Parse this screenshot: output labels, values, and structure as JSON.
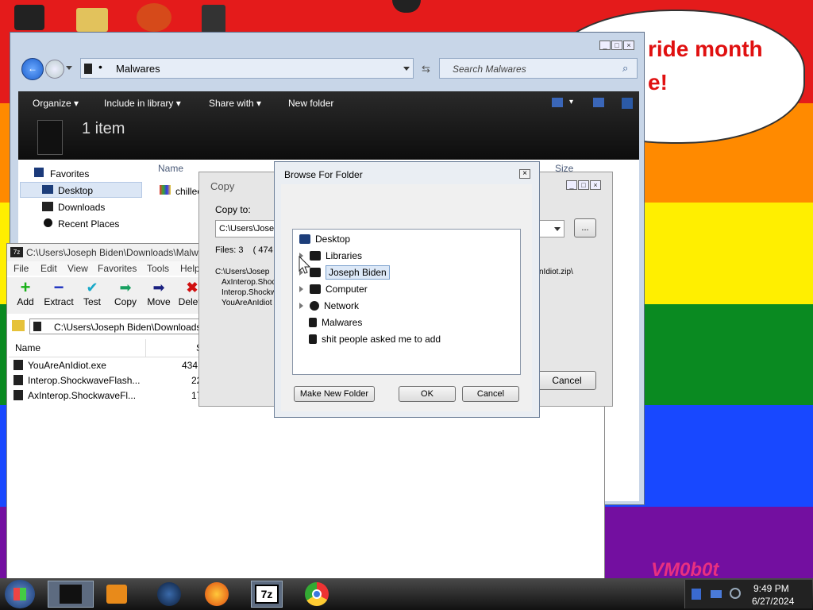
{
  "wallpaper": {
    "bubble_lines": [
      "ride month",
      "e!"
    ]
  },
  "explorer": {
    "location": "Malwares",
    "search_placeholder": "Search Malwares",
    "toolbar": [
      "Organize",
      "Include in library",
      "Share with",
      "New folder"
    ],
    "item_count": "1 item",
    "nav": [
      "Favorites",
      "Desktop",
      "Downloads",
      "Recent Places"
    ],
    "col_name": "Name",
    "col_size": "Size",
    "file_name": "chillec"
  },
  "sevenzip": {
    "title": "C:\\Users\\Joseph Biden\\Downloads\\Malwa",
    "menu": [
      "File",
      "Edit",
      "View",
      "Favorites",
      "Tools",
      "Help"
    ],
    "toolbar": [
      "Add",
      "Extract",
      "Test",
      "Copy",
      "Move",
      "Delete"
    ],
    "path": "C:\\Users\\Joseph Biden\\Downloads\\",
    "col_name": "Name",
    "col_size": "S",
    "files": [
      {
        "name": "YouAreAnIdiot.exe",
        "size": "434 ("
      },
      {
        "name": "Interop.ShockwaveFlash...",
        "size": "22 ("
      },
      {
        "name": "AxInterop.ShockwaveFl...",
        "size": "17 4"
      }
    ]
  },
  "copy_dialog": {
    "title": "Copy",
    "copy_to_label": "Copy to:",
    "copy_to_value": "C:\\Users\\Josep",
    "browse_label": "...",
    "files_text": "Files: 3    ( 474",
    "list_head": "C:\\Users\\Josep",
    "list_tail": "nIdiot.zip\\",
    "items": [
      "AxInterop.Shoc",
      "Interop.Shockw",
      "YouAreAnIdiot"
    ],
    "cancel": "Cancel"
  },
  "browse": {
    "title": "Browse For Folder",
    "tree": [
      "Desktop",
      "Libraries",
      "Joseph Biden",
      "Computer",
      "Network",
      "Malwares",
      "shit people asked me to add"
    ],
    "make_new_folder": "Make New Folder",
    "ok": "OK",
    "cancel": "Cancel"
  },
  "watermark": "VM0b0t",
  "taskbar": {
    "time": "9:49 PM",
    "date": "6/27/2024",
    "sevenzip_label": "7z"
  }
}
